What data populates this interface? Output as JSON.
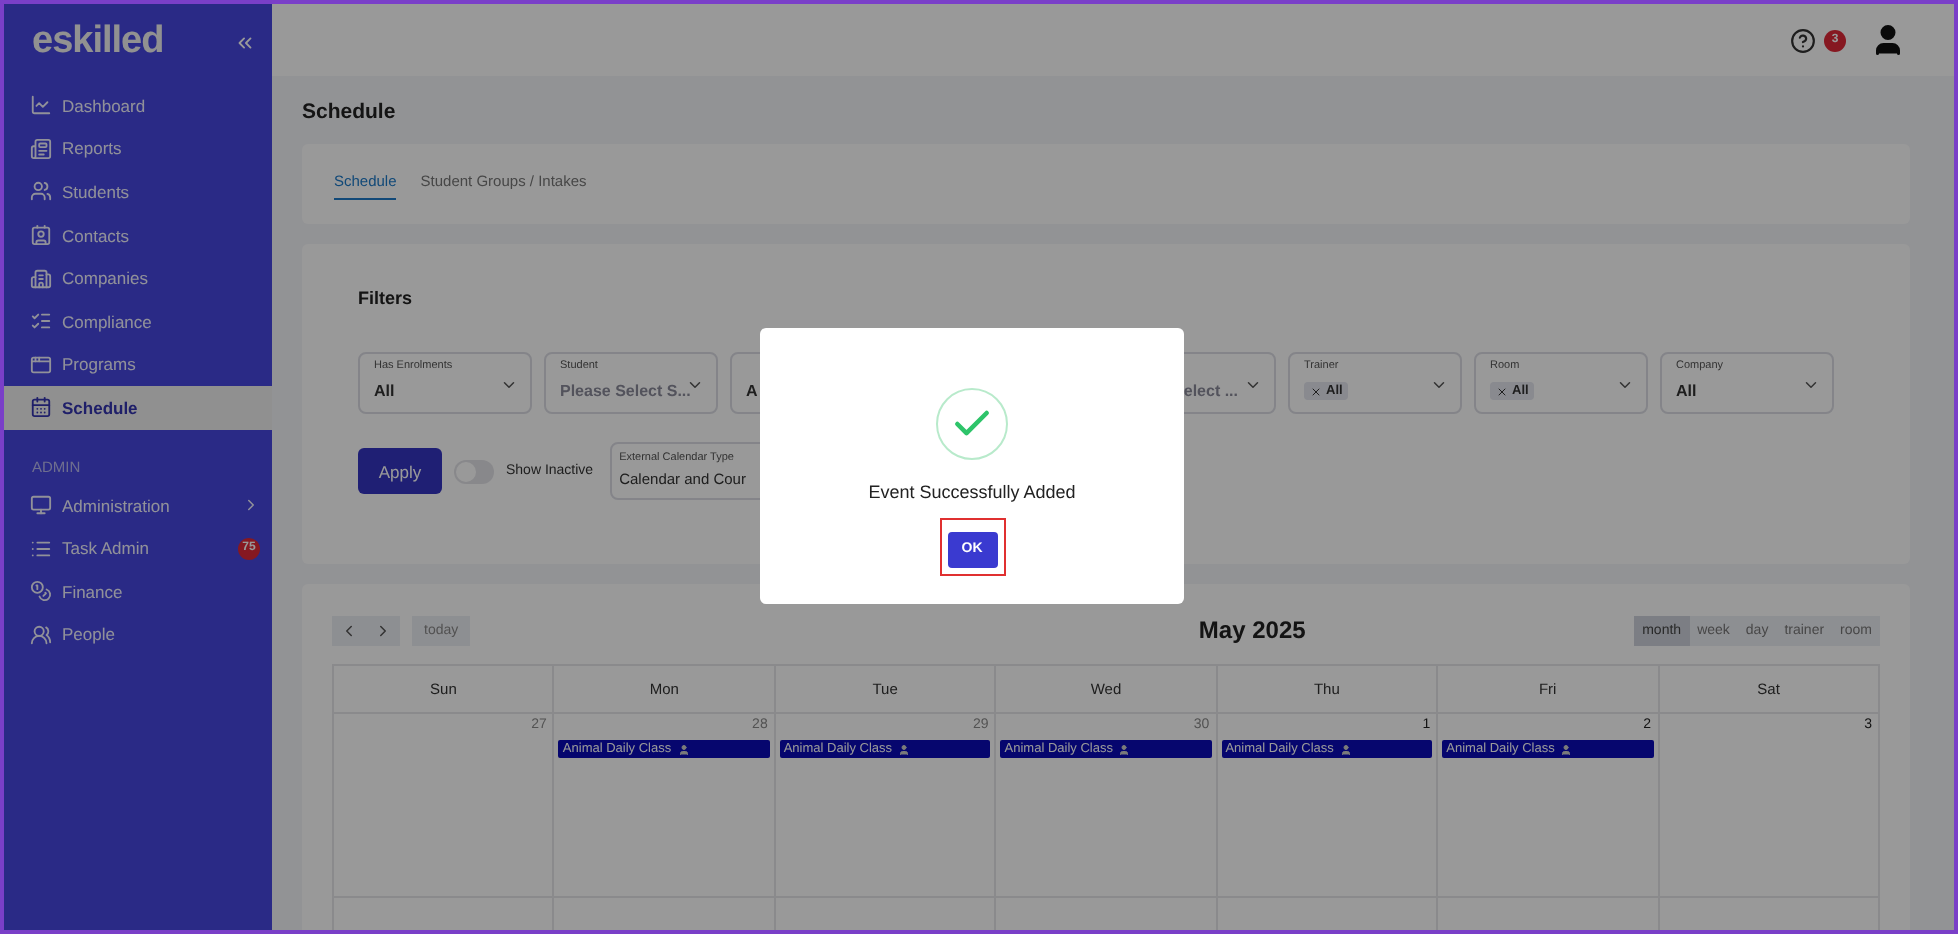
{
  "sidebar": {
    "logo": "eskilled",
    "items": [
      {
        "label": "Dashboard",
        "selected": false
      },
      {
        "label": "Reports",
        "selected": false
      },
      {
        "label": "Students",
        "selected": false
      },
      {
        "label": "Contacts",
        "selected": false
      },
      {
        "label": "Companies",
        "selected": false
      },
      {
        "label": "Compliance",
        "selected": false
      },
      {
        "label": "Programs",
        "selected": false
      },
      {
        "label": "Schedule",
        "selected": true
      }
    ],
    "section": "ADMIN",
    "admin_items": [
      {
        "label": "Administration",
        "submenu": true
      },
      {
        "label": "Task Admin",
        "badge": "75"
      },
      {
        "label": "Finance"
      },
      {
        "label": "People"
      }
    ]
  },
  "topbar": {
    "help_badge": "3"
  },
  "page_title": "Schedule",
  "tabs": [
    {
      "label": "Schedule",
      "selected": true
    },
    {
      "label": "Student Groups / Intakes",
      "selected": false
    }
  ],
  "filters": {
    "title": "Filters",
    "fields": [
      {
        "label": "Has Enrolments",
        "value": "All",
        "kind": "plain"
      },
      {
        "label": "Student",
        "placeholder": "Please Select S...",
        "kind": "plain"
      },
      {
        "value": "A",
        "kind": "plain"
      },
      {
        "kind": "hidden"
      },
      {
        "placeholder": "elect ...",
        "kind": "plain",
        "hidden_start": true
      },
      {
        "label": "Trainer",
        "value": "All",
        "kind": "chip"
      },
      {
        "label": "Room",
        "value": "All",
        "kind": "chip"
      },
      {
        "label": "Company",
        "value": "All",
        "kind": "plain"
      }
    ],
    "apply": "Apply",
    "show_inactive": {
      "label": "Show Inactive",
      "on": false
    },
    "calendar_type": {
      "label": "External Calendar Type",
      "value": "Calendar and Cour"
    }
  },
  "calendar": {
    "title": "May 2025",
    "today": "today",
    "views": [
      {
        "label": "month",
        "selected": true
      },
      {
        "label": "week",
        "selected": false
      },
      {
        "label": "day",
        "selected": false
      },
      {
        "label": "trainer",
        "selected": false
      },
      {
        "label": "room",
        "selected": false
      }
    ],
    "weekdays": [
      "Sun",
      "Mon",
      "Tue",
      "Wed",
      "Thu",
      "Fri",
      "Sat"
    ],
    "days": [
      {
        "number": "27",
        "other_month": true
      },
      {
        "number": "28",
        "other_month": true,
        "event": "Animal Daily Class"
      },
      {
        "number": "29",
        "other_month": true,
        "event": "Animal Daily Class"
      },
      {
        "number": "30",
        "other_month": true,
        "event": "Animal Daily Class"
      },
      {
        "number": "1",
        "other_month": false,
        "event": "Animal Daily Class"
      },
      {
        "number": "2",
        "other_month": false,
        "event": "Animal Daily Class"
      },
      {
        "number": "3",
        "other_month": false
      }
    ]
  },
  "dialog": {
    "message": "Event Successfully Added",
    "button": "OK"
  }
}
